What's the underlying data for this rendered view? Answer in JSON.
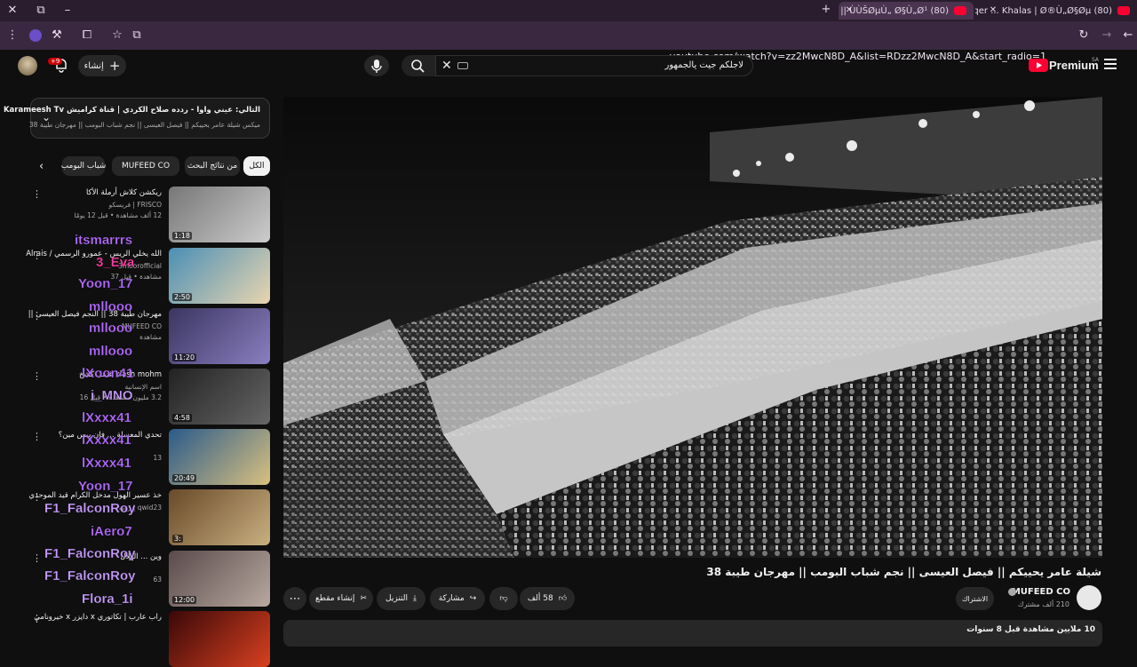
{
  "browser": {
    "tabs": [
      {
        "title": "(80) Rabeh Saqer ... Khalas | Ø®Ù„Ø§Øµ",
        "active": false
      },
      {
        "title": "(80) Ø´ÙŠÙ„Ø© Ø¹Ø§Ù…Ø± ÙŠØ­ÙŠÙŠÙƒÙ… || ÙÙŠØµÙ„ Ø§Ù„Ø¹...",
        "active": true
      }
    ],
    "url": "youtube.com/watch?v=zz2MwcN8D_A&list=RDzz2MwcN8D_A&start_radio=1",
    "new_tab": "+",
    "close": "✕"
  },
  "header": {
    "logo_text": "Premium",
    "logo_sup": "SA",
    "search_value": "لاجلكم جيت يالجمهور",
    "create_label": "إنشاء",
    "notif_count": "+9"
  },
  "playlist": {
    "title": "التالي: عيني واوا - ردده صلاح الكردي | قناة كراميش Karameesh Tv",
    "subtitle": "ميكس شيلة عامر يحييكم || فيصل العيسى || نجم شباب البومب || مهرجان طيبة 38"
  },
  "chips": [
    "الكل",
    "من نتائج البحث",
    "MUFEED CO",
    "شباب البومب"
  ],
  "related": [
    {
      "title": "ريكشن كلاش أرملة الأكا",
      "channel": "FRISCO | فريسكو",
      "meta": "12 ألف مشاهدة • قبل 12 يومًا",
      "duration": "1:18",
      "c1": "#777",
      "c2": "#ccc"
    },
    {
      "title": "الله يخلي الريس - عمورو الرسمي / Alrais",
      "channel": "3moorofficial",
      "meta": "مشاهدة • قبل 37",
      "duration": "2:50",
      "c1": "#4a8fb5",
      "c2": "#e9d5b0"
    },
    {
      "title": "مهرجان طيبة 38 || النجم فيصل العيسى ||",
      "channel": "MUFEED CO",
      "meta": "مشاهدة",
      "duration": "11:20",
      "c1": "#3a3560",
      "c2": "#8a7fc0"
    },
    {
      "title": "klash mohm غتمل كشخ",
      "channel": "اسم الإنسانية",
      "meta": "3.2 مليون مشاهدة • قبل 16",
      "duration": "4:58",
      "c1": "#222",
      "c2": "#666"
    },
    {
      "title": "تحدي المعسلة ... فان بيس مين؟",
      "channel": "",
      "meta": "13",
      "duration": "20:49",
      "c1": "#2a5a8a",
      "c2": "#d8c080"
    },
    {
      "title": "خذ عسير الهول مدخل الكرام قيد الموحدي",
      "channel": "qwid23 | رؤيه",
      "meta": "",
      "duration": "3:",
      "c1": "#6a4a2a",
      "c2": "#c8b080"
    },
    {
      "title": "وين ... الهلال",
      "channel": "",
      "meta": "63",
      "duration": "12:00",
      "c1": "#5a4a4a",
      "c2": "#b8a8a0"
    },
    {
      "title": "راب عارب | تكاتوري x دايزر x خيرونامي",
      "channel": "",
      "meta": "",
      "duration": "",
      "c1": "#3a0808",
      "c2": "#d84020"
    }
  ],
  "chat_overlay": [
    {
      "name": "itsmarrrs",
      "color": "#b36bff"
    },
    {
      "name": "3_Eva",
      "color": "#ff3da6"
    },
    {
      "name": "Yoon_17",
      "color": "#b36bff"
    },
    {
      "name": "mllooo",
      "color": "#b36bff"
    },
    {
      "name": "mllooo",
      "color": "#b36bff"
    },
    {
      "name": "mllooo",
      "color": "#b36bff"
    },
    {
      "name": "lXoon41",
      "color": "#b36bff"
    },
    {
      "name": "i_MNO",
      "color": "#c89bff"
    },
    {
      "name": "lXxxx41",
      "color": "#b36bff"
    },
    {
      "name": "lXxxx41",
      "color": "#b36bff"
    },
    {
      "name": "lXxxx41",
      "color": "#b36bff"
    },
    {
      "name": "Yoon_17",
      "color": "#b36bff"
    },
    {
      "name": "F1_FalconRoy",
      "color": "#c89bff"
    },
    {
      "name": "iAero7",
      "color": "#b36bff"
    },
    {
      "name": "F1_FalconRoy",
      "color": "#c89bff"
    },
    {
      "name": "F1_FalconRoy",
      "color": "#c89bff"
    },
    {
      "name": "Flora_1i",
      "color": "#c89bff"
    }
  ],
  "video": {
    "title": "شيلة عامر يحييكم || فيصل العيسى || نجم شباب البومب || مهرجان طيبة 38",
    "channel": "MUFEED CO",
    "subscribers": "210 ألف مشترك",
    "join_label": "الاشتراك",
    "likes": "58 ألف",
    "share_label": "مشاركة",
    "download_label": "التنزيل",
    "clip_label": "إنشاء مقطع",
    "views": "10 ملايين مشاهدة  قبل 8 سنوات"
  }
}
